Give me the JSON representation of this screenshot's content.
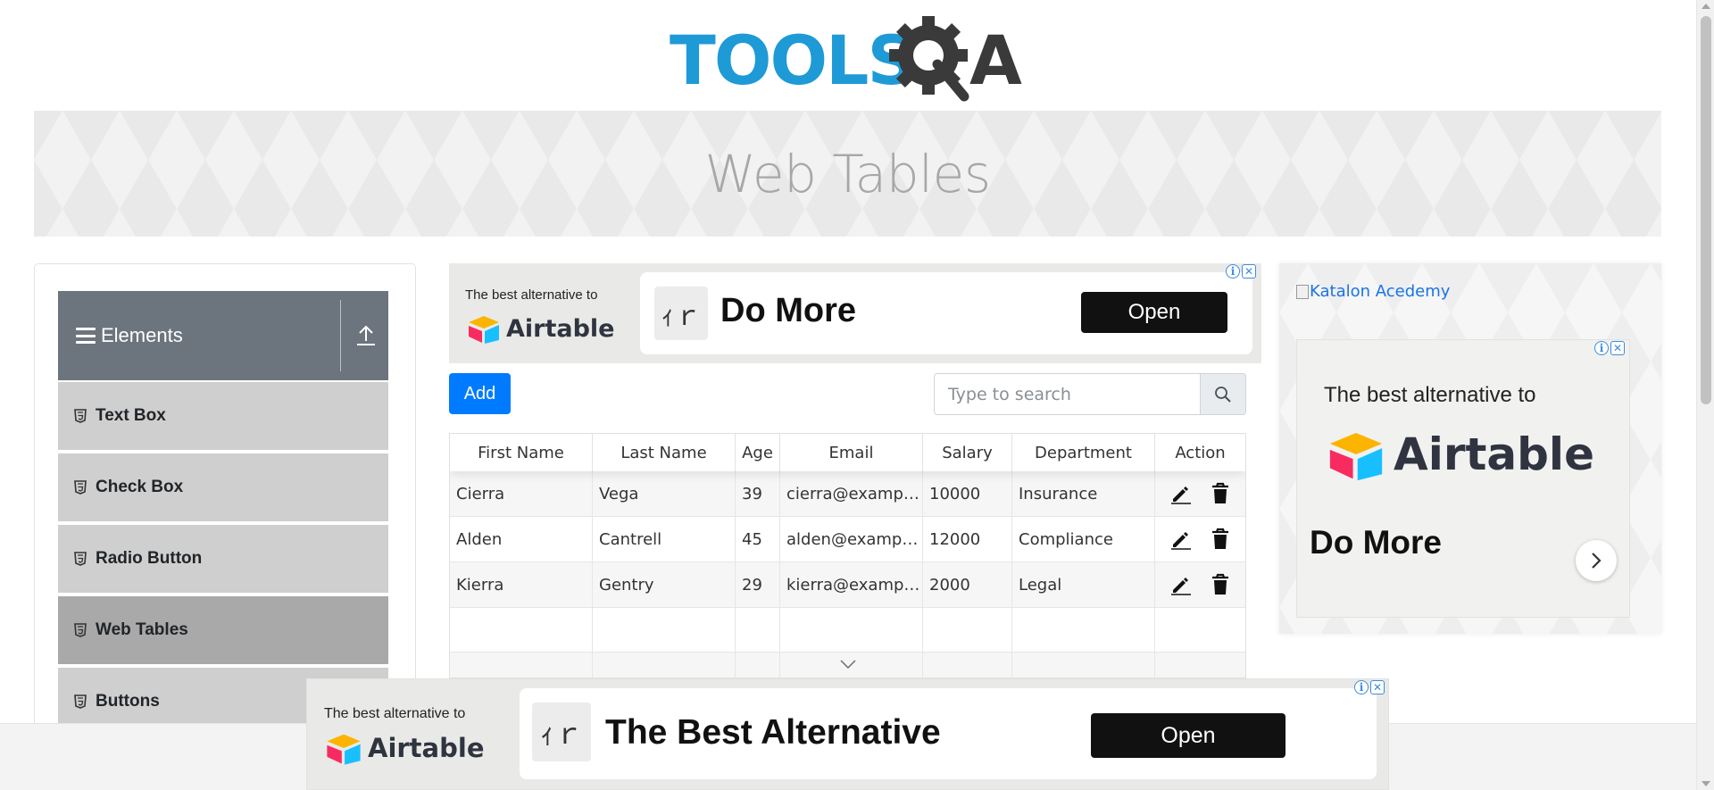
{
  "header": {
    "logo_text_left": "TOOLS",
    "logo_text_right": "A",
    "colors": {
      "logo_blue": "#1e9ad6",
      "logo_dark": "#3a3a3a"
    }
  },
  "banner": {
    "title": "Web Tables"
  },
  "sidebar": {
    "group_title": "Elements",
    "items": [
      {
        "label": "Text Box",
        "active": false
      },
      {
        "label": "Check Box",
        "active": false
      },
      {
        "label": "Radio Button",
        "active": false
      },
      {
        "label": "Web Tables",
        "active": true
      },
      {
        "label": "Buttons",
        "active": false
      }
    ]
  },
  "ad_top": {
    "small_text": "The best alternative to",
    "brand": "Airtable",
    "headline": "Do More",
    "button": "Open"
  },
  "toolbar": {
    "add_label": "Add",
    "search_placeholder": "Type to search"
  },
  "table": {
    "headers": [
      "First Name",
      "Last Name",
      "Age",
      "Email",
      "Salary",
      "Department",
      "Action"
    ],
    "rows": [
      [
        "Cierra",
        "Vega",
        "39",
        "cierra@example.com",
        "10000",
        "Insurance"
      ],
      [
        "Alden",
        "Cantrell",
        "45",
        "alden@example.com",
        "12000",
        "Compliance"
      ],
      [
        "Kierra",
        "Gentry",
        "29",
        "kierra@example.com",
        "2000",
        "Legal"
      ]
    ]
  },
  "ad_right": {
    "link_text": "Katalon Acedemy",
    "small_text": "The best alternative to",
    "brand": "Airtable",
    "headline": "Do More"
  },
  "ad_bottom": {
    "small_text": "The best alternative to",
    "brand": "Airtable",
    "headline": "The Best Alternative",
    "button": "Open"
  },
  "colors": {
    "accent": "#007bff",
    "sidebar_header": "#6c757d",
    "menu_item": "#cfcfcf",
    "menu_active": "#a9a9a9"
  }
}
